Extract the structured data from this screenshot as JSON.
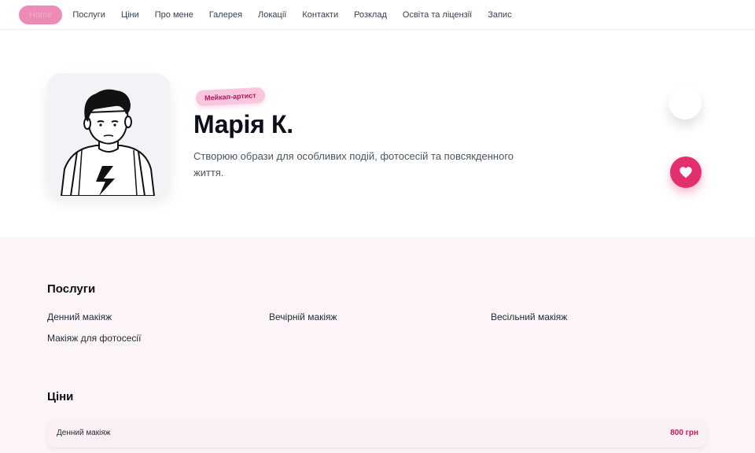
{
  "nav": {
    "items": [
      {
        "label": "Home",
        "active": true
      },
      {
        "label": "Послуги"
      },
      {
        "label": "Ціни"
      },
      {
        "label": "Про мене"
      },
      {
        "label": "Галерея"
      },
      {
        "label": "Локації"
      },
      {
        "label": "Контакти"
      },
      {
        "label": "Розклад"
      },
      {
        "label": "Освіта та ліцензії"
      },
      {
        "label": "Запис"
      }
    ]
  },
  "hero": {
    "badge": "Мейкап-артист",
    "name": "Марія К.",
    "tagline": "Створюю образи для особливих подій, фотосесій та повсякденного життя.",
    "avatar_icon": "illustrated-person-avatar",
    "heart_icon": "heart-icon"
  },
  "services": {
    "title": "Послуги",
    "items": [
      "Денний макіяж",
      "Вечірній макіяж",
      "Весільний макіяж",
      "Макіяж для фотосесії"
    ]
  },
  "prices": {
    "title": "Ціни",
    "rows": [
      {
        "name": "Денний макіяж",
        "price": "800 грн"
      }
    ]
  },
  "colors": {
    "accent": "#e2306f",
    "accent_soft": "#f9c6dd",
    "section_bg": "#fdf4f7"
  }
}
